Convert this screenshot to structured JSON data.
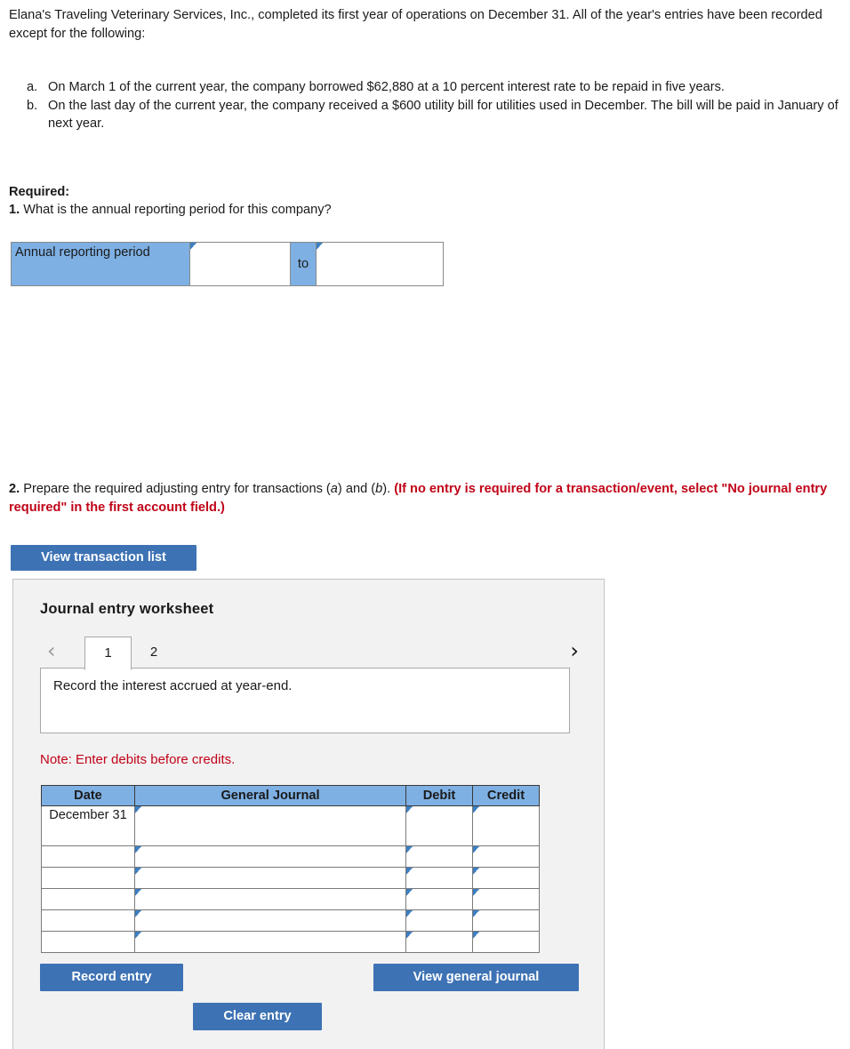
{
  "intro": {
    "paragraph": "Elana's Traveling Veterinary Services, Inc., completed its first year of operations on December 31. All of the year's entries have been recorded except for the following:"
  },
  "problems": [
    {
      "marker": "a.",
      "text": "On March 1 of the current year, the company borrowed $62,880 at a 10 percent interest rate to be repaid in five years."
    },
    {
      "marker": "b.",
      "text": "On the last day of the current year, the company received a $600 utility bill for utilities used in December. The bill will be paid in January of next year."
    }
  ],
  "required": {
    "heading": "Required:",
    "q1_num": "1.",
    "q1_text": " What is the annual reporting period for this company?"
  },
  "annual_reporting_period": {
    "label": "Annual reporting period",
    "start_value": "",
    "separator": "to",
    "end_value": ""
  },
  "question2": {
    "num": "2.",
    "text_plain_1": " Prepare the required adjusting entry for transactions (",
    "italic_a": "a",
    "text_plain_2": ") and (",
    "italic_b": "b",
    "text_plain_3": "). ",
    "text_red": "(If no entry is required for a transaction/event, select \"No journal entry required\" in the first account field.)"
  },
  "buttons": {
    "view_transaction_list": "View transaction list",
    "record_entry": "Record entry",
    "clear_entry": "Clear entry",
    "view_general_journal": "View general journal"
  },
  "worksheet": {
    "title": "Journal entry worksheet",
    "prev_chevron": "‹",
    "next_chevron": "›",
    "tabs": [
      {
        "label": "1",
        "active": true
      },
      {
        "label": "2",
        "active": false
      }
    ],
    "description": "Record the interest accrued at year-end.",
    "note": "Note: Enter debits before credits."
  },
  "journal_table": {
    "headers": [
      "Date",
      "General Journal",
      "Debit",
      "Credit"
    ],
    "rows": [
      {
        "date": "December 31",
        "general_journal": "",
        "debit": "",
        "credit": ""
      },
      {
        "date": "",
        "general_journal": "",
        "debit": "",
        "credit": ""
      },
      {
        "date": "",
        "general_journal": "",
        "debit": "",
        "credit": ""
      },
      {
        "date": "",
        "general_journal": "",
        "debit": "",
        "credit": ""
      },
      {
        "date": "",
        "general_journal": "",
        "debit": "",
        "credit": ""
      },
      {
        "date": "",
        "general_journal": "",
        "debit": "",
        "credit": ""
      }
    ]
  },
  "colors": {
    "button_blue": "#3d72b4",
    "header_blue": "#7eb0e3",
    "note_red": "#c00418",
    "panel_bg": "#f2f2f2"
  }
}
